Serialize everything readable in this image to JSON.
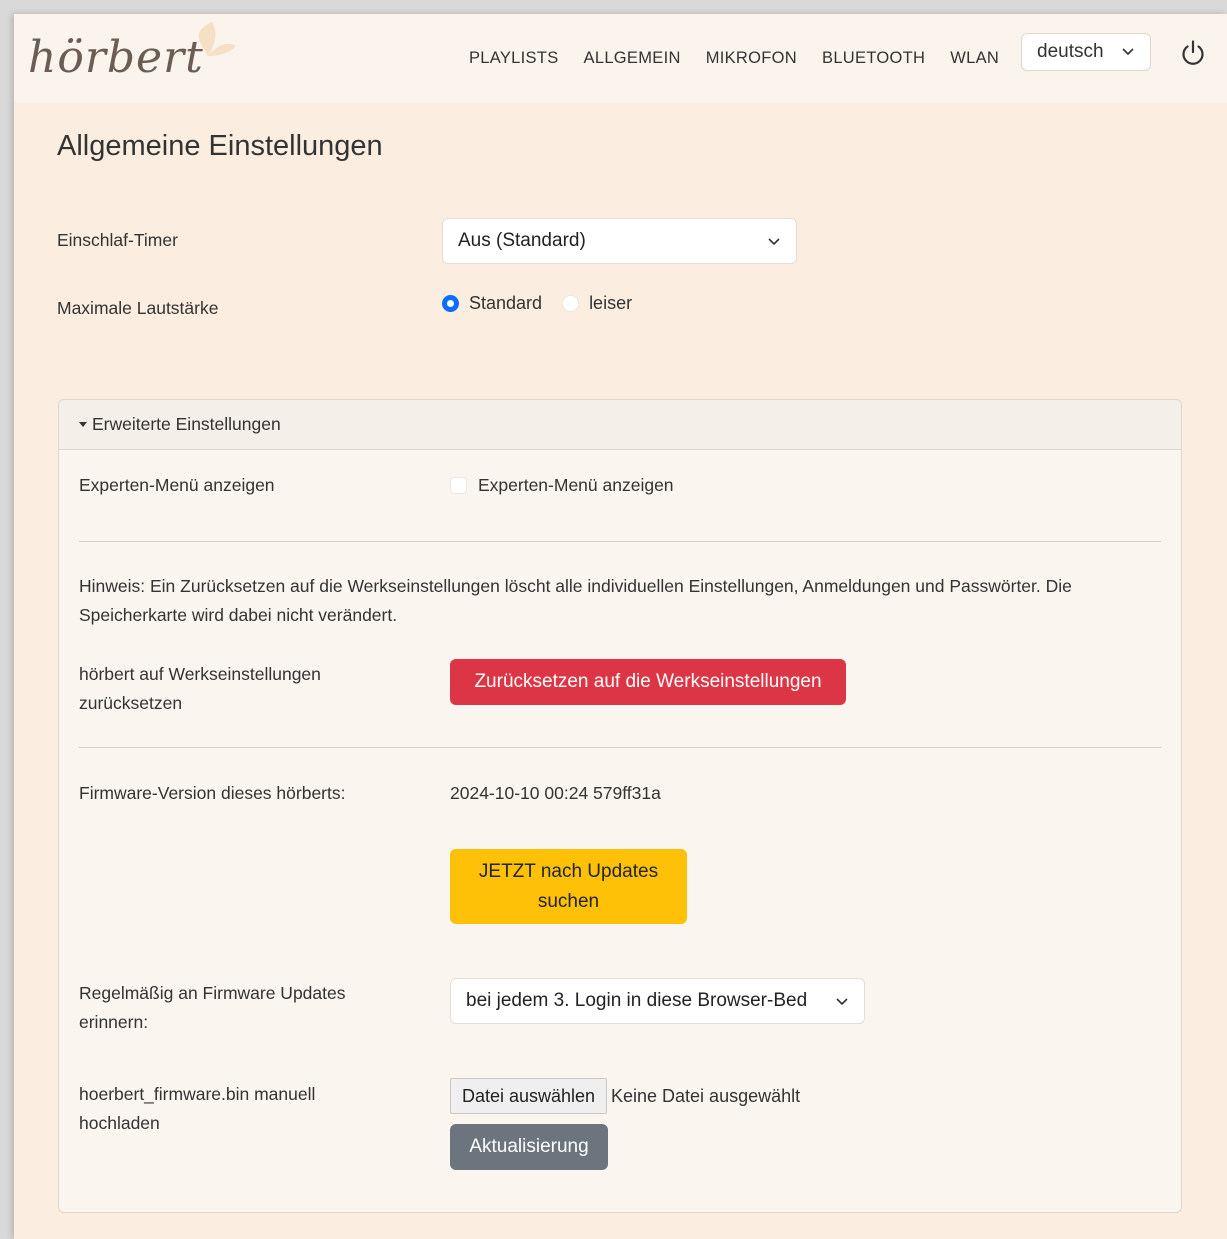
{
  "header": {
    "logo_text": "hörbert",
    "nav": [
      "PLAYLISTS",
      "ALLGEMEIN",
      "MIKROFON",
      "BLUETOOTH",
      "WLAN"
    ],
    "language": "deutsch"
  },
  "main": {
    "title": "Allgemeine Einstellungen",
    "sleep_timer": {
      "label": "Einschlaf-Timer",
      "value": "Aus (Standard)"
    },
    "max_volume": {
      "label": "Maximale Lautstärke",
      "options": [
        "Standard",
        "leiser"
      ],
      "selected": "Standard"
    }
  },
  "advanced": {
    "heading": "Erweiterte Einstellungen",
    "expert_menu": {
      "label": "Experten-Menü anzeigen",
      "checkbox_label": "Experten-Menü anzeigen",
      "checked": false
    },
    "notice": "Hinweis: Ein Zurücksetzen auf die Werkseinstellungen löscht alle individuellen Einstellungen, Anmeldungen und Passwörter. Die Speicherkarte wird dabei nicht verändert.",
    "reset": {
      "label": "hörbert auf Werkseinstellungen zurücksetzen",
      "button": "Zurücksetzen auf die Werkseinstellungen"
    },
    "firmware": {
      "label": "Firmware-Version dieses hörberts:",
      "version": "2024-10-10 00:24 579ff31a",
      "check_button": "JETZT nach Updates suchen"
    },
    "reminder": {
      "label": "Regelmäßig an Firmware Updates erinnern:",
      "value": "bei jedem 3. Login in diese Browser-Bed"
    },
    "manual_upload": {
      "label": "hoerbert_firmware.bin manuell hochladen",
      "file_button": "Datei auswählen",
      "file_status": "Keine Datei ausgewählt",
      "update_button": "Aktualisierung"
    }
  },
  "colors": {
    "background": "#fbeee0",
    "header": "#fbf4ec",
    "danger": "#dc3545",
    "warning": "#ffc107",
    "secondary": "#6c757d",
    "primary": "#0d6efd"
  }
}
